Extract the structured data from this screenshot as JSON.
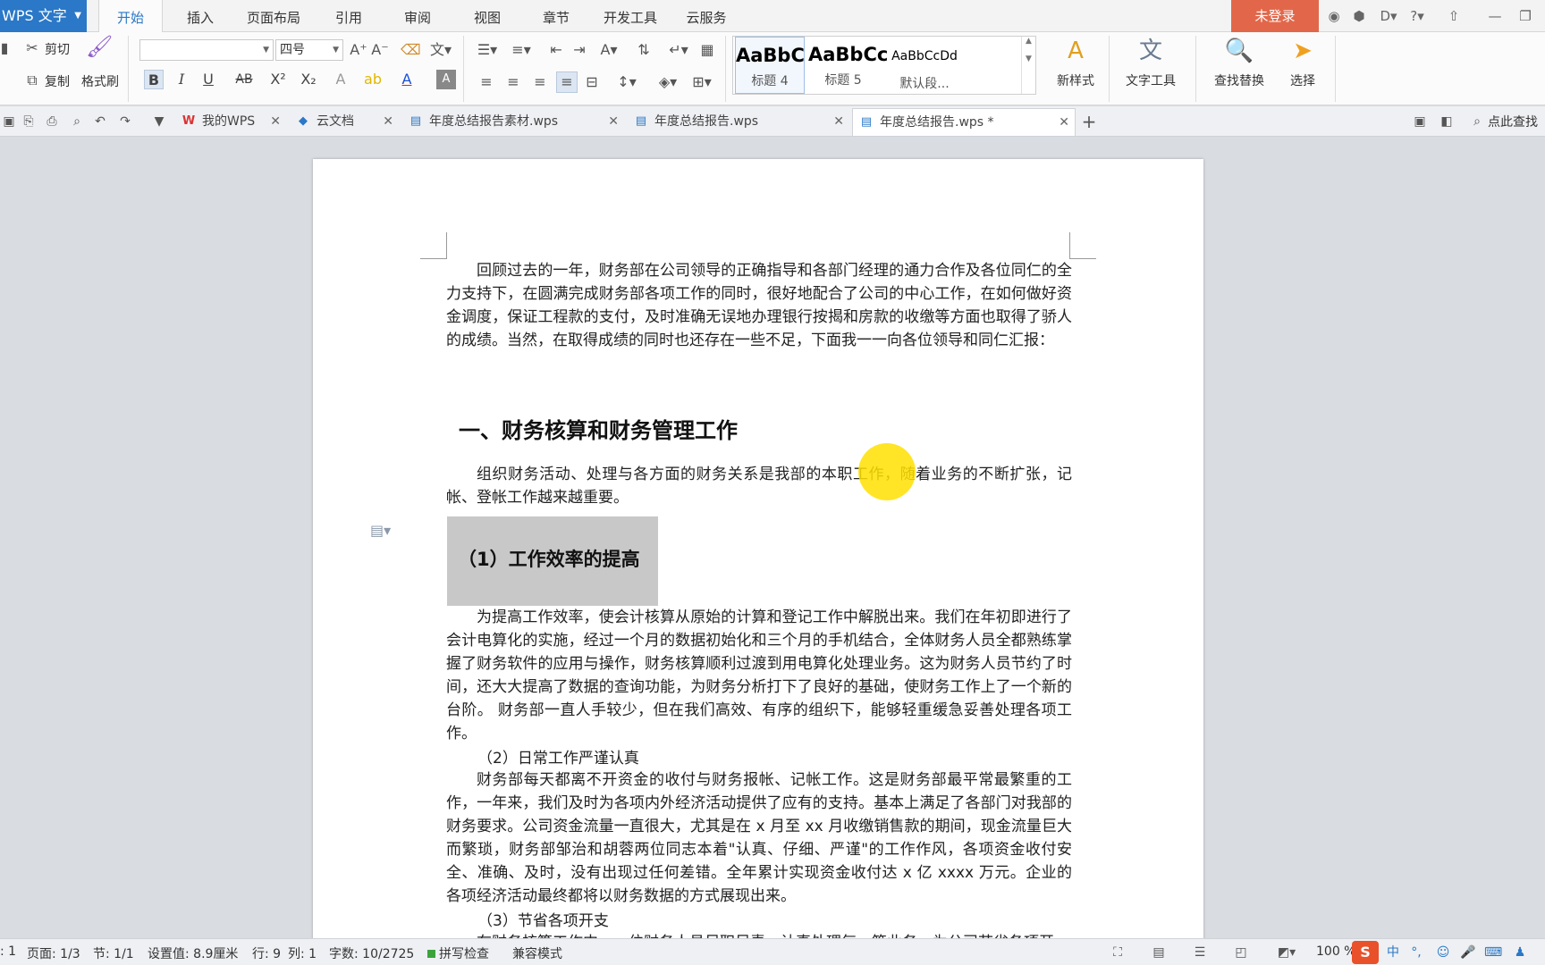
{
  "app": {
    "name": "WPS 文字"
  },
  "menu": {
    "tabs": [
      {
        "label": "开始"
      },
      {
        "label": "插入"
      },
      {
        "label": "页面布局"
      },
      {
        "label": "引用"
      },
      {
        "label": "审阅"
      },
      {
        "label": "视图"
      },
      {
        "label": "章节"
      },
      {
        "label": "开发工具"
      },
      {
        "label": "云服务"
      }
    ],
    "login_label": "未登录"
  },
  "ribbon": {
    "cut_label": "剪切",
    "copy_label": "复制",
    "format_painter_label": "格式刷",
    "font_name_value": "",
    "font_size_value": "四号",
    "styles": [
      {
        "preview": "AaBbC",
        "label": "标题 4"
      },
      {
        "preview": "AaBbCc",
        "label": "标题 5"
      },
      {
        "preview": "AaBbCcDd",
        "label": "默认段..."
      }
    ],
    "new_style_label": "新样式",
    "text_tools_label": "文字工具",
    "find_replace_label": "查找替换",
    "select_label": "选择"
  },
  "doc_tabs": [
    {
      "label": "我的WPS"
    },
    {
      "label": "云文档"
    },
    {
      "label": "年度总结报告素材.wps"
    },
    {
      "label": "年度总结报告.wps"
    },
    {
      "label": "年度总结报告.wps *"
    }
  ],
  "search_hint": "点此查找",
  "document": {
    "p1": "回顾过去的一年，财务部在公司领导的正确指导和各部门经理的通力合作及各位同仁的全力支持下，在圆满完成财务部各项工作的同时，很好地配合了公司的中心工作，在如何做好资金调度，保证工程款的支付，及时准确无误地办理银行按揭和房款的收缴等方面也取得了骄人的成绩。当然，在取得成绩的同时也还存在一些不足，下面我一一向各位领导和同仁汇报：",
    "h1": "一、财务核算和财务管理工作",
    "p2": "组织财务活动、处理与各方面的财务关系是我部的本职工作，随着业务的不断扩张，记帐、登帐工作越来越重要。",
    "h2": "（1）工作效率的提高",
    "p3": "为提高工作效率，使会计核算从原始的计算和登记工作中解脱出来。我们在年初即进行了会计电算化的实施，经过一个月的数据初始化和三个月的手机结合，全体财务人员全都熟练掌握了财务软件的应用与操作，财务核算顺利过渡到用电算化处理业务。这为财务人员节约了时间，还大大提高了数据的查询功能，为财务分析打下了良好的基础，使财务工作上了一个新的台阶。 财务部一直人手较少，但在我们高效、有序的组织下，能够轻重缓急妥善处理各项工作。",
    "s2": "（2）日常工作严谨认真",
    "p4": "财务部每天都离不开资金的收付与财务报帐、记帐工作。这是财务部最平常最繁重的工作，一年来，我们及时为各项内外经济活动提供了应有的支持。基本上满足了各部门对我部的财务要求。公司资金流量一直很大，尤其是在 x 月至 xx 月收缴销售款的期间，现金流量巨大而繁琐，财务部邹治和胡蓉两位同志本着\"认真、仔细、严谨\"的工作作风，各项资金收付安全、准确、及时，没有出现过任何差错。全年累计实现资金收付达 x 亿 xxxx 万元。企业的各项经济活动最终都将以财务数据的方式展现出来。",
    "s3": "（3）节省各项开支",
    "p5": "在财务核算工作中，一位财务人员尽职尽责，认真处理每一笔业务，为公司节省各项开"
  },
  "status": {
    "section_short": ": 1",
    "page": "页面: 1/3",
    "section": "节: 1/1",
    "position": "设置值: 8.9厘米",
    "row": "行: 9",
    "col": "列: 1",
    "word_count": "字数: 10/2725",
    "spell_check": "拼写检查",
    "compat_mode": "兼容模式",
    "zoom": "100 %"
  },
  "colors": {
    "accent": "#2a78c7",
    "login": "#e2674a",
    "highlight": "#c8c8c8",
    "cursor_dot": "#ffe100"
  }
}
